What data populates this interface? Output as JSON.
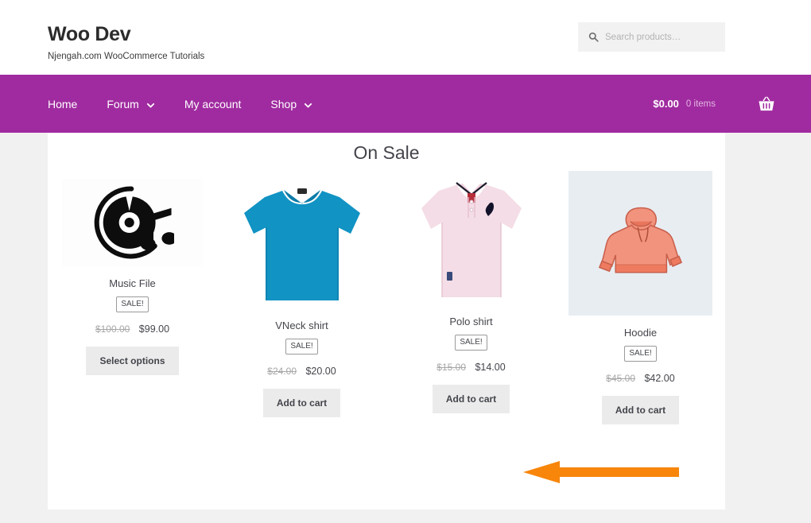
{
  "header": {
    "brand_title": "Woo Dev",
    "brand_tagline": "Njengah.com WooCommerce Tutorials",
    "search": {
      "placeholder": "Search products…",
      "value": "",
      "icon": "search-icon"
    }
  },
  "nav": {
    "background_color": "#a02ba0",
    "items": [
      {
        "label": "Home",
        "has_dropdown": false
      },
      {
        "label": "Forum",
        "has_dropdown": true
      },
      {
        "label": "My account",
        "has_dropdown": false
      },
      {
        "label": "Shop",
        "has_dropdown": true
      }
    ],
    "cart": {
      "amount": "$0.00",
      "count": "0 items",
      "icon": "shopping-basket-icon"
    }
  },
  "main": {
    "section_title": "On Sale",
    "products": [
      {
        "name": "Music File",
        "badge": "SALE!",
        "price_old": "$100.00",
        "price_new": "$99.00",
        "button": "Select options",
        "image": "music-file-disc-icon",
        "image_bg": "#fdfdfd"
      },
      {
        "name": "VNeck shirt",
        "badge": "SALE!",
        "price_old": "$24.00",
        "price_new": "$20.00",
        "button": "Add to cart",
        "image": "blue-tshirt-photo",
        "image_bg": "#ffffff"
      },
      {
        "name": "Polo shirt",
        "badge": "SALE!",
        "price_old": "$15.00",
        "price_new": "$14.00",
        "button": "Add to cart",
        "image": "pink-polo-shirt-photo",
        "image_bg": "#ffffff"
      },
      {
        "name": "Hoodie",
        "badge": "SALE!",
        "price_old": "$45.00",
        "price_new": "$42.00",
        "button": "Add to cart",
        "image": "orange-hoodie-illustration",
        "image_bg": "#e8edf2"
      }
    ]
  },
  "annotation": {
    "arrow": {
      "direction": "left",
      "color": "#f7860b"
    }
  }
}
